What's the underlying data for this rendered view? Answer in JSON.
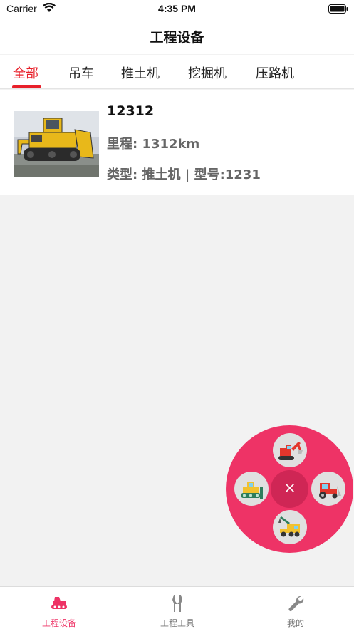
{
  "status_bar": {
    "carrier": "Carrier",
    "time": "4:35 PM"
  },
  "nav": {
    "title": "工程设备"
  },
  "tabs": [
    {
      "label": "全部",
      "active": true
    },
    {
      "label": "吊车",
      "active": false
    },
    {
      "label": "推土机",
      "active": false
    },
    {
      "label": "挖掘机",
      "active": false
    },
    {
      "label": "压路机",
      "active": false
    }
  ],
  "items": [
    {
      "title": "12312",
      "mileage": "里程: 1312km",
      "type_model": "类型: 推土机 | 型号:1231",
      "image_icon": "bulldozer-photo"
    }
  ],
  "fab_menu": {
    "items": [
      "excavator-icon",
      "bulldozer-icon",
      "tractor-icon",
      "crane-truck-icon"
    ],
    "close_icon": "close-icon",
    "ring_color": "#ee3366"
  },
  "tab_bar": [
    {
      "label": "工程设备",
      "icon": "equipment-icon",
      "active": true
    },
    {
      "label": "工程工具",
      "icon": "tools-icon",
      "active": false
    },
    {
      "label": "我的",
      "icon": "wrench-icon",
      "active": false
    }
  ],
  "colors": {
    "accent": "#e8202a",
    "fab": "#ee3366",
    "background": "#f2f2f2"
  }
}
